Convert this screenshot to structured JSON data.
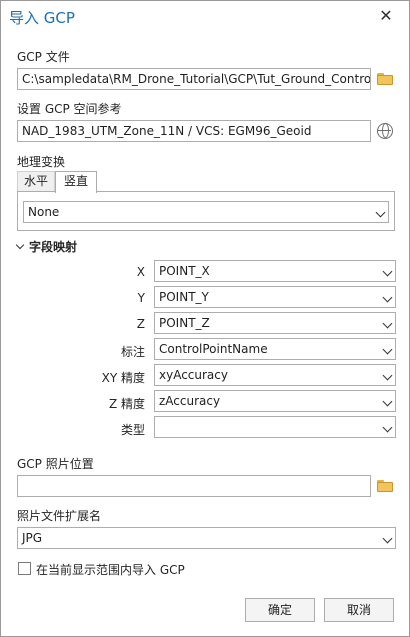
{
  "dialog": {
    "title": "导入 GCP",
    "close_glyph": "✕"
  },
  "gcp_file": {
    "label": "GCP 文件",
    "value": "C:\\sampledata\\RM_Drone_Tutorial\\GCP\\Tut_Ground_Control",
    "browse_icon": "folder-icon"
  },
  "spatial_ref": {
    "label": "设置 GCP 空间参考",
    "value": "NAD_1983_UTM_Zone_11N / VCS: EGM96_Geoid",
    "icon": "globe-icon"
  },
  "geo_transform": {
    "label": "地理变换",
    "tabs": [
      "水平",
      "竖直"
    ],
    "active_tab": "竖直",
    "value": "None"
  },
  "field_mapping": {
    "header": "字段映射",
    "rows": [
      {
        "label": "X",
        "value": "POINT_X"
      },
      {
        "label": "Y",
        "value": "POINT_Y"
      },
      {
        "label": "Z",
        "value": "POINT_Z"
      },
      {
        "label": "标注",
        "value": "ControlPointName"
      },
      {
        "label": "XY 精度",
        "value": "xyAccuracy"
      },
      {
        "label": "Z 精度",
        "value": "zAccuracy"
      },
      {
        "label": "类型",
        "value": ""
      }
    ]
  },
  "photo_location": {
    "label": "GCP 照片位置",
    "value": "",
    "browse_icon": "folder-icon"
  },
  "photo_ext": {
    "label": "照片文件扩展名",
    "value": "JPG"
  },
  "import_extent": {
    "label": "在当前显示范围内导入 GCP",
    "checked": false
  },
  "buttons": {
    "ok": "确定",
    "cancel": "取消"
  }
}
